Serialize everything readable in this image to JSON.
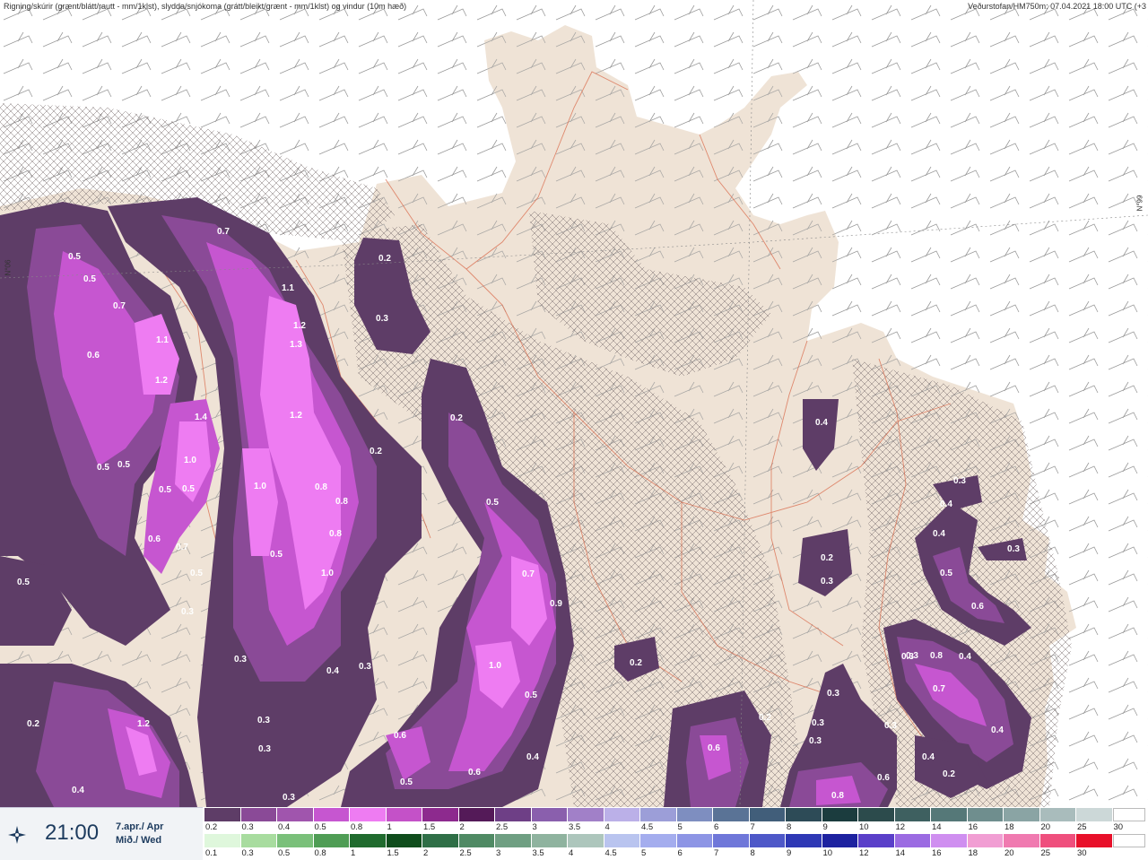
{
  "header": {
    "left": "Rigning/skúrir (grænt/blátt/rautt - mm/1klst), slydda/snjókoma (grátt/bleikt/grænt - mm/1klst) og vindur (10m hæð)",
    "right": "Veðurstofan/HM750m: 07.04.2021 18:00 UTC (+3"
  },
  "latitude_labels": {
    "left": "N°06",
    "right": "N°99"
  },
  "time_panel": {
    "time": "21:00",
    "date_line1": "7.apr./ Apr",
    "date_line2": "Mið./ Wed"
  },
  "colors": {
    "land": "#efe3d6",
    "sea": "#ffffff",
    "road": "#d9694a",
    "precip_dark": "#5e3d67",
    "precip_mid": "#8a4a97",
    "precip_light": "#c656d0",
    "precip_bright": "#ee7cf2"
  },
  "legend": {
    "snow_labels": [
      "0.2",
      "0.3",
      "0.4",
      "0.5",
      "0.8",
      "1",
      "1.5",
      "2",
      "2.5",
      "3",
      "3.5",
      "4",
      "4.5",
      "5",
      "6",
      "7",
      "8",
      "9",
      "10",
      "12",
      "14",
      "16",
      "18",
      "20",
      "25",
      "30"
    ],
    "snow_colors": [
      "#5e3d67",
      "#8a4a97",
      "#a055ad",
      "#c656d0",
      "#ee7cf2",
      "#c451c8",
      "#8d2a8e",
      "#541a58",
      "#6e3f86",
      "#8a5fad",
      "#a180c8",
      "#bbb0e8",
      "#9c9ed8",
      "#7e8ec0",
      "#5a7396",
      "#415e7a",
      "#2d4b57",
      "#1b3c3e",
      "#2c4b4c",
      "#3e6060",
      "#557878",
      "#6f8e8e",
      "#8aa4a4",
      "#a9bcbc",
      "#ccd8d8"
    ],
    "rain_labels": [
      "0.1",
      "0.3",
      "0.5",
      "0.8",
      "1",
      "1.5",
      "2",
      "2.5",
      "3",
      "3.5",
      "4",
      "4.5",
      "5",
      "6",
      "7",
      "8",
      "9",
      "10",
      "12",
      "14",
      "16",
      "18",
      "20",
      "25",
      "30"
    ],
    "rain_colors": [
      "#dff7dc",
      "#a8dc9f",
      "#7ac07a",
      "#4f9d55",
      "#206b2e",
      "#0f4d1c",
      "#2f6f47",
      "#4f8a64",
      "#6f9f82",
      "#8fb39f",
      "#adc6bc",
      "#b9c4ef",
      "#a4adee",
      "#8d95e5",
      "#6f77d9",
      "#4e58c8",
      "#2e38b5",
      "#1d22a0",
      "#5a3fc9",
      "#9b6be2",
      "#cf8ff0",
      "#f19ed3",
      "#f07ab0",
      "#ef4f7d",
      "#e8102a"
    ]
  },
  "map_values": [
    {
      "label": "0.5"
    },
    {
      "label": "0.5"
    },
    {
      "label": "0.7"
    },
    {
      "label": "0.6"
    },
    {
      "label": "0.7"
    },
    {
      "label": "1.1"
    },
    {
      "label": "1.2"
    },
    {
      "label": "1.3"
    },
    {
      "label": "1.2"
    },
    {
      "label": "0.2"
    },
    {
      "label": "1.1"
    },
    {
      "label": "1.2"
    },
    {
      "label": "1.4"
    },
    {
      "label": "1.0"
    },
    {
      "label": "0.5"
    },
    {
      "label": "0.5"
    },
    {
      "label": "0.5"
    },
    {
      "label": "0.5"
    },
    {
      "label": "0.6"
    },
    {
      "label": "0.7"
    },
    {
      "label": "0.5"
    },
    {
      "label": "0.3"
    },
    {
      "label": "1.0"
    },
    {
      "label": "0.8"
    },
    {
      "label": "0.8"
    },
    {
      "label": "0.8"
    },
    {
      "label": "0.5"
    },
    {
      "label": "1.0"
    },
    {
      "label": "0.3"
    },
    {
      "label": "0.4"
    },
    {
      "label": "0.3"
    },
    {
      "label": "0.3"
    },
    {
      "label": "0.3"
    },
    {
      "label": "0.3"
    },
    {
      "label": "0.5"
    },
    {
      "label": "1.2"
    },
    {
      "label": "0.4"
    },
    {
      "label": "0.2"
    },
    {
      "label": "0.2"
    },
    {
      "label": "0.3"
    },
    {
      "label": "0.2"
    },
    {
      "label": "0.5"
    },
    {
      "label": "0.7"
    },
    {
      "label": "0.9"
    },
    {
      "label": "1.0"
    },
    {
      "label": "0.5"
    },
    {
      "label": "0.4"
    },
    {
      "label": "0.6"
    },
    {
      "label": "0.6"
    },
    {
      "label": "0.5"
    },
    {
      "label": "0.2"
    },
    {
      "label": "0.2"
    },
    {
      "label": "0.6"
    },
    {
      "label": "0.4"
    },
    {
      "label": "0.2"
    },
    {
      "label": "0.3"
    },
    {
      "label": "0.3"
    },
    {
      "label": "0.3"
    },
    {
      "label": "0.3"
    },
    {
      "label": "0.6"
    },
    {
      "label": "0.8"
    },
    {
      "label": "0.3"
    },
    {
      "label": "0.3"
    },
    {
      "label": "0.4"
    },
    {
      "label": "0.4"
    },
    {
      "label": "0.5"
    },
    {
      "label": "0.6"
    },
    {
      "label": "0.3"
    },
    {
      "label": "0.3"
    },
    {
      "label": "0.8"
    },
    {
      "label": "0.7"
    },
    {
      "label": "0.4"
    },
    {
      "label": "0.4"
    },
    {
      "label": "0.4"
    },
    {
      "label": "0.2"
    },
    {
      "label": "0.3"
    }
  ]
}
